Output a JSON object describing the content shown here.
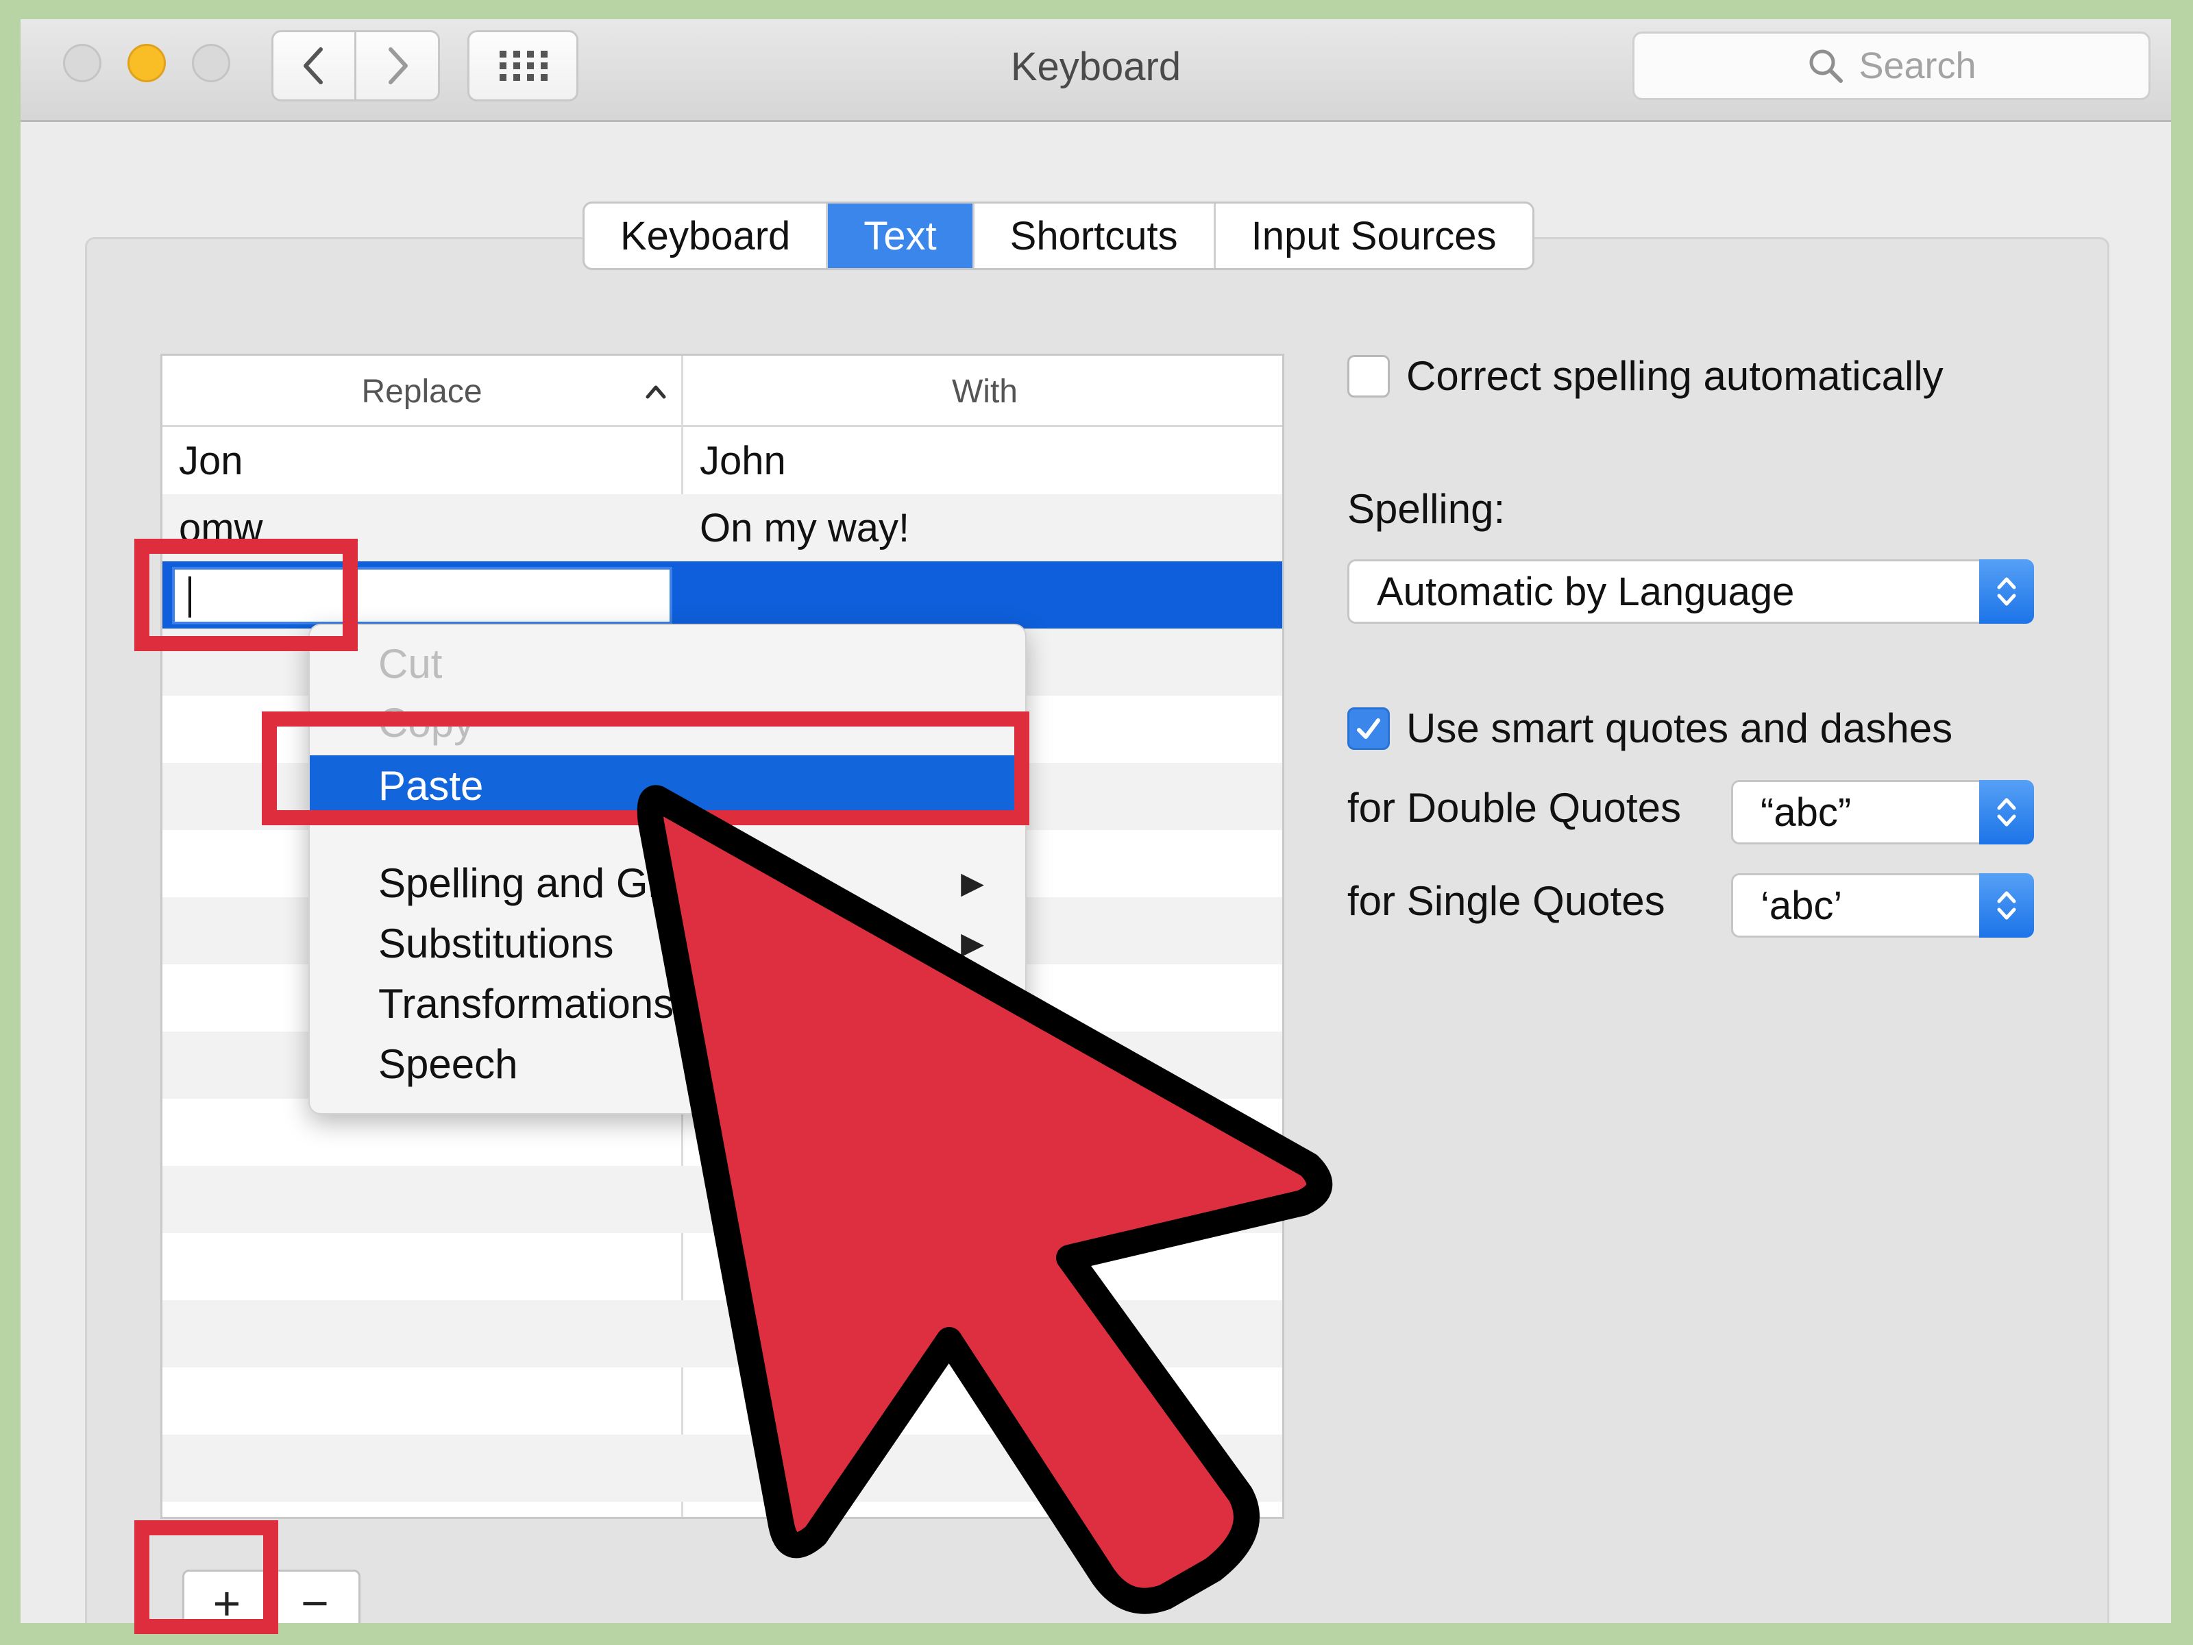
{
  "window": {
    "title": "Keyboard",
    "search_placeholder": "Search"
  },
  "tabs": [
    {
      "label": "Keyboard",
      "active": false
    },
    {
      "label": "Text",
      "active": true
    },
    {
      "label": "Shortcuts",
      "active": false
    },
    {
      "label": "Input Sources",
      "active": false
    }
  ],
  "table": {
    "headers": {
      "replace": "Replace",
      "with": "With"
    },
    "rows": [
      {
        "replace": "Jon",
        "with": "John"
      },
      {
        "replace": "omw",
        "with": "On my way!"
      }
    ],
    "buttons": {
      "add": "+",
      "remove": "−"
    }
  },
  "context_menu": {
    "items": [
      {
        "label": "Cut",
        "disabled": true
      },
      {
        "label": "Copy",
        "disabled": true
      },
      {
        "label": "Paste",
        "highlighted": true
      },
      {
        "label": "Spelling and Grammar",
        "submenu": true
      },
      {
        "label": "Substitutions",
        "submenu": true
      },
      {
        "label": "Transformations",
        "submenu": true
      },
      {
        "label": "Speech",
        "submenu": true
      }
    ],
    "submenu_arrow": "▶"
  },
  "settings": {
    "correct_spelling": {
      "label": "Correct spelling automatically",
      "checked": false
    },
    "spelling_label": "Spelling:",
    "spelling_value": "Automatic by Language",
    "smart_quotes": {
      "label": "Use smart quotes and dashes",
      "checked": true
    },
    "double_quotes_label": "for Double Quotes",
    "double_quotes_value": "“abc”",
    "single_quotes_label": "for Single Quotes",
    "single_quotes_value": "‘abc’"
  },
  "colors": {
    "accent": "#3b86ea",
    "selection": "#0f5fdc",
    "annotation_red": "#de2d3d",
    "background_green": "#b8d4a4"
  },
  "icons": {
    "back": "chevron-left-icon",
    "forward": "chevron-right-icon",
    "grid": "grid-icon",
    "search": "search-icon",
    "cursor": "mouse-pointer-icon"
  }
}
